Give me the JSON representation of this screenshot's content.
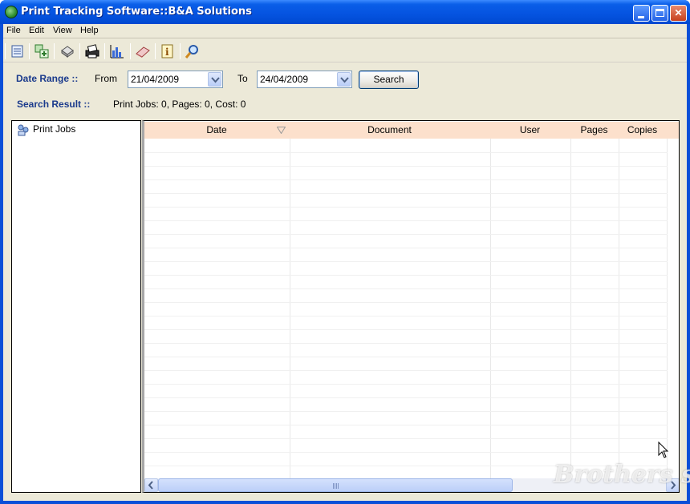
{
  "window": {
    "title": "Print Tracking Software::B&A Solutions",
    "controls": {
      "minimize": "",
      "maximize": "",
      "close": "✕"
    }
  },
  "menu": [
    "File",
    "Edit",
    "View",
    "Help"
  ],
  "toolbar": {
    "icons": [
      "list-icon",
      "add-icon",
      "print-settings-icon",
      "printer-icon",
      "bar-chart-icon",
      "eraser-icon",
      "info-icon",
      "search-icon"
    ]
  },
  "date_range": {
    "label": "Date Range ::",
    "from_label": "From",
    "from_value": "21/04/2009",
    "to_label": "To",
    "to_value": "24/04/2009",
    "search_button": "Search"
  },
  "search_result": {
    "label": "Search Result ::",
    "text": "Print Jobs: 0, Pages: 0, Cost: 0"
  },
  "tree": {
    "items": [
      {
        "label": "Print Jobs",
        "icon": "print-jobs-icon"
      }
    ]
  },
  "grid": {
    "columns": [
      "Date",
      "Document",
      "User",
      "Pages",
      "Copies"
    ],
    "rows": []
  },
  "watermark": "Brothers soft",
  "colors": {
    "title_bar": "#0553e0",
    "client_bg": "#ece9d8",
    "header_bg": "#fce0cc",
    "label_blue": "#1a3a8c"
  }
}
